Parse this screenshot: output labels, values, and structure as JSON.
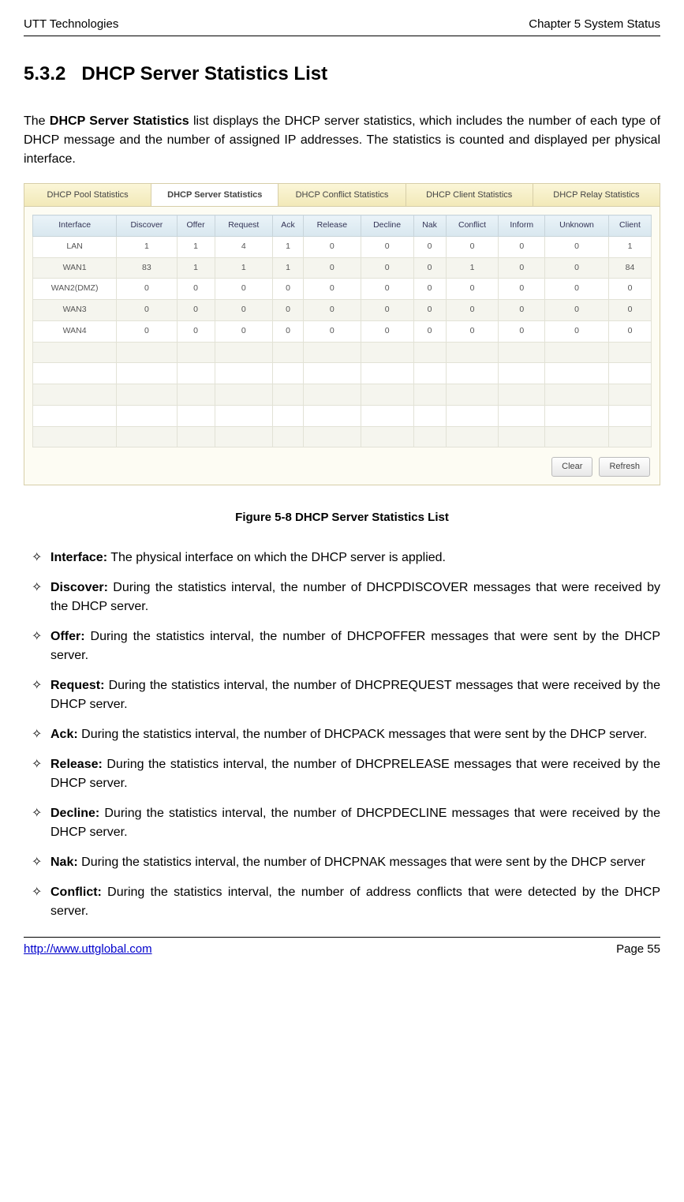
{
  "header": {
    "left": "UTT Technologies",
    "right": "Chapter 5 System Status"
  },
  "section": {
    "number": "5.3.2",
    "title": "DHCP Server Statistics List"
  },
  "intro": {
    "pre": "The ",
    "bold": "DHCP Server Statistics",
    "post": " list displays the DHCP server statistics, which includes the number of each type of DHCP message and the number of assigned IP addresses. The statistics is counted and displayed per physical interface."
  },
  "tabs": [
    "DHCP Pool Statistics",
    "DHCP Server Statistics",
    "DHCP Conflict Statistics",
    "DHCP Client Statistics",
    "DHCP Relay Statistics"
  ],
  "activeTab": 1,
  "tableHeaders": [
    "Interface",
    "Discover",
    "Offer",
    "Request",
    "Ack",
    "Release",
    "Decline",
    "Nak",
    "Conflict",
    "Inform",
    "Unknown",
    "Client"
  ],
  "tableRows": [
    [
      "LAN",
      "1",
      "1",
      "4",
      "1",
      "0",
      "0",
      "0",
      "0",
      "0",
      "0",
      "1"
    ],
    [
      "WAN1",
      "83",
      "1",
      "1",
      "1",
      "0",
      "0",
      "0",
      "1",
      "0",
      "0",
      "84"
    ],
    [
      "WAN2(DMZ)",
      "0",
      "0",
      "0",
      "0",
      "0",
      "0",
      "0",
      "0",
      "0",
      "0",
      "0"
    ],
    [
      "WAN3",
      "0",
      "0",
      "0",
      "0",
      "0",
      "0",
      "0",
      "0",
      "0",
      "0",
      "0"
    ],
    [
      "WAN4",
      "0",
      "0",
      "0",
      "0",
      "0",
      "0",
      "0",
      "0",
      "0",
      "0",
      "0"
    ]
  ],
  "emptyRows": 5,
  "buttons": {
    "clear": "Clear",
    "refresh": "Refresh"
  },
  "caption": "Figure 5-8 DHCP Server Statistics List",
  "defs": [
    {
      "term": "Interface:",
      "desc": " The physical interface on which the DHCP server is applied."
    },
    {
      "term": "Discover:",
      "desc": " During the statistics interval, the number of DHCPDISCOVER messages that were received by the DHCP server."
    },
    {
      "term": "Offer:",
      "desc": " During the statistics interval, the number of DHCPOFFER messages that were sent by the DHCP server."
    },
    {
      "term": "Request:",
      "desc": " During the statistics interval, the number of DHCPREQUEST messages that were received by the DHCP server."
    },
    {
      "term": "Ack:",
      "desc": " During the statistics interval, the number of DHCPACK messages that were sent by the DHCP server."
    },
    {
      "term": "Release:",
      "desc": " During the statistics interval, the number of DHCPRELEASE messages that were received by the DHCP server."
    },
    {
      "term": "Decline:",
      "desc": " During the statistics interval, the number of DHCPDECLINE messages that were received by the DHCP server."
    },
    {
      "term": "Nak:",
      "desc": " During the statistics interval, the number of DHCPNAK messages that were sent by the DHCP server"
    },
    {
      "term": "Conflict:",
      "desc": " During the statistics interval, the number of address conflicts that were detected by the DHCP server."
    }
  ],
  "footer": {
    "url": "http://www.uttglobal.com",
    "page": "Page 55"
  }
}
